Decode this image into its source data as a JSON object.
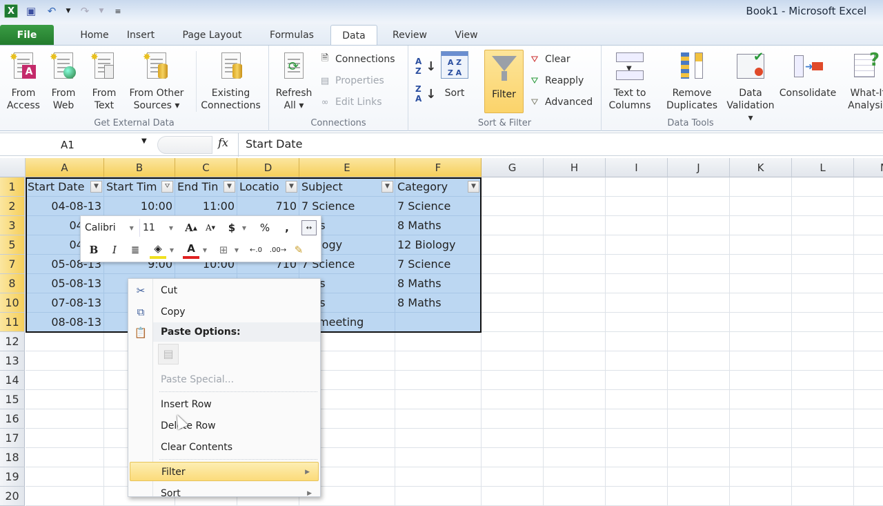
{
  "window": {
    "title": "Book1  -  Microsoft Excel"
  },
  "quick_access": {
    "icons": [
      "excel-logo",
      "save",
      "undo",
      "undo-dropdown",
      "redo",
      "redo-dropdown",
      "customize"
    ]
  },
  "tabs": [
    {
      "label": "File"
    },
    {
      "label": "Home"
    },
    {
      "label": "Insert"
    },
    {
      "label": "Page Layout"
    },
    {
      "label": "Formulas"
    },
    {
      "label": "Data",
      "active": true
    },
    {
      "label": "Review"
    },
    {
      "label": "View"
    }
  ],
  "ribbon": {
    "get_external_data": {
      "label": "Get External Data",
      "buttons": [
        {
          "line1": "From",
          "line2": "Access"
        },
        {
          "line1": "From",
          "line2": "Web"
        },
        {
          "line1": "From",
          "line2": "Text"
        },
        {
          "line1": "From Other",
          "line2": "Sources ▾"
        },
        {
          "line1": "Existing",
          "line2": "Connections"
        }
      ]
    },
    "connections": {
      "label": "Connections",
      "refresh": {
        "line1": "Refresh",
        "line2": "All ▾"
      },
      "connections": "Connections",
      "properties": "Properties",
      "edit_links": "Edit Links"
    },
    "sort_filter": {
      "label": "Sort & Filter",
      "sort": "Sort",
      "filter": "Filter",
      "clear": "Clear",
      "reapply": "Reapply",
      "advanced": "Advanced"
    },
    "data_tools": {
      "label": "Data Tools",
      "buttons": [
        {
          "line1": "Text to",
          "line2": "Columns"
        },
        {
          "line1": "Remove",
          "line2": "Duplicates"
        },
        {
          "line1": "Data",
          "line2": "Validation ▾"
        },
        {
          "line1": "Consolidate",
          "line2": ""
        },
        {
          "line1": "What-If",
          "line2": "Analysis"
        }
      ]
    }
  },
  "formula_bar": {
    "name_box": "A1",
    "fx": "fx",
    "content": "Start Date"
  },
  "sheet": {
    "columns": [
      "A",
      "B",
      "C",
      "D",
      "E",
      "F",
      "G",
      "H",
      "I",
      "J",
      "K",
      "L",
      "M"
    ],
    "header_row": {
      "row": "1",
      "cells": [
        "Start Date",
        "Start Tim",
        "End Tin",
        "Locatio",
        "Subject",
        "Category"
      ]
    },
    "rows": [
      {
        "row": "2",
        "cells": [
          "04-08-13",
          "10:00",
          "11:00",
          "710",
          "7 Science",
          "7 Science"
        ]
      },
      {
        "row": "3",
        "cells": [
          "04-08",
          "",
          "",
          "",
          "aths",
          "8 Maths"
        ]
      },
      {
        "row": "5",
        "cells": [
          "04-08",
          "",
          "",
          "",
          "Biology",
          "12 Biology"
        ]
      },
      {
        "row": "7",
        "cells": [
          "05-08-13",
          "9:00",
          "10:00",
          "710",
          "7 Science",
          "7 Science"
        ]
      },
      {
        "row": "8",
        "cells": [
          "05-08-13",
          "",
          "",
          "",
          "aths",
          "8 Maths"
        ]
      },
      {
        "row": "10",
        "cells": [
          "07-08-13",
          "",
          "",
          "",
          "aths",
          "8 Maths"
        ]
      },
      {
        "row": "11",
        "cells": [
          "08-08-13",
          "",
          "",
          "",
          "ch meeting",
          ""
        ]
      }
    ],
    "empty_rows": [
      "12",
      "13",
      "14",
      "15",
      "16",
      "17",
      "18",
      "19",
      "20"
    ]
  },
  "mini_toolbar": {
    "font": "Calibri",
    "size": "11"
  },
  "context_menu": {
    "items": [
      {
        "label": "Cut",
        "icon": "scissors"
      },
      {
        "label": "Copy",
        "icon": "copy"
      },
      {
        "label": "Paste Options:",
        "icon": "paste",
        "bold": true
      },
      {
        "label": "Paste Special...",
        "disabled": true
      },
      {
        "label": "Insert Row"
      },
      {
        "label": "Delete Row"
      },
      {
        "label": "Clear Contents"
      },
      {
        "label": "Filter",
        "submenu": true,
        "highlighted": true
      },
      {
        "label": "Sort",
        "submenu": true
      }
    ]
  }
}
